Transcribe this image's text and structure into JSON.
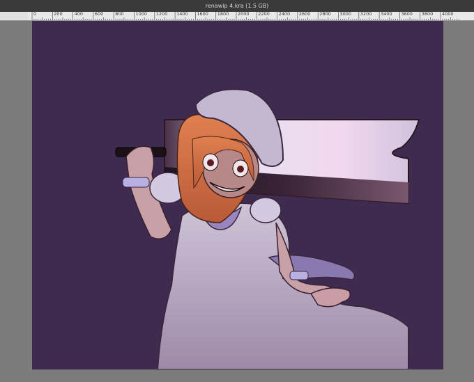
{
  "window": {
    "title": "renawip 4.kra (1.5 GB)"
  },
  "ruler": {
    "labels": [
      "0",
      "200",
      "400",
      "600",
      "800",
      "1000",
      "1200",
      "1400",
      "1600",
      "1800",
      "2000",
      "2200",
      "2400",
      "2600",
      "2800",
      "3000",
      "3200",
      "3400",
      "3600",
      "3800",
      "4000"
    ]
  },
  "canvas": {
    "background_color": "#3e2b4f",
    "content": "digital illustration"
  },
  "colors": {
    "workspace": "#7b7b7b",
    "titlebar": "#3a3a3a",
    "ruler": "#e9e9e9"
  }
}
